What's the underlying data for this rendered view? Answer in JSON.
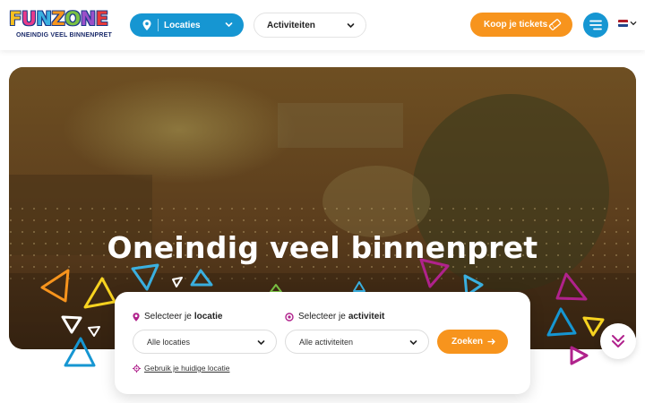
{
  "header": {
    "logo": {
      "letters": [
        "F",
        "U",
        "N",
        "Z",
        "O",
        "N",
        "E"
      ],
      "letter_colors": [
        "#f7c020",
        "#e83a8a",
        "#3ab0e0",
        "#f7941d",
        "#7ac143",
        "#9b4fc8",
        "#e83a3a"
      ],
      "tagline": "ONEINDIG VEEL BINNENPRET"
    },
    "locations_button": {
      "label": "Locaties",
      "icon": "map-pin-icon"
    },
    "activities_button": {
      "label": "Activiteiten"
    },
    "tickets_button": {
      "label": "Koop je tickets",
      "icon": "ticket-icon"
    },
    "menu_button": {
      "icon": "hamburger-icon"
    },
    "language": {
      "flag": "nl-flag-icon",
      "flag_colors": [
        "#ae1c28",
        "#ffffff",
        "#21468b"
      ]
    }
  },
  "hero": {
    "title": "Oneindig veel binnenpret"
  },
  "search": {
    "location_label_prefix": "Selecteer je",
    "location_label_bold": "locatie",
    "activity_label_prefix": "Selecteer je",
    "activity_label_bold": "activiteit",
    "location_select_value": "Alle locaties",
    "activity_select_value": "Alle activiteiten",
    "search_button_label": "Zoeken",
    "use_location_link": "Gebruik je huidige locatie"
  },
  "colors": {
    "primary_blue": "#1696d2",
    "accent_orange": "#f7941d",
    "magenta": "#b0228c"
  }
}
